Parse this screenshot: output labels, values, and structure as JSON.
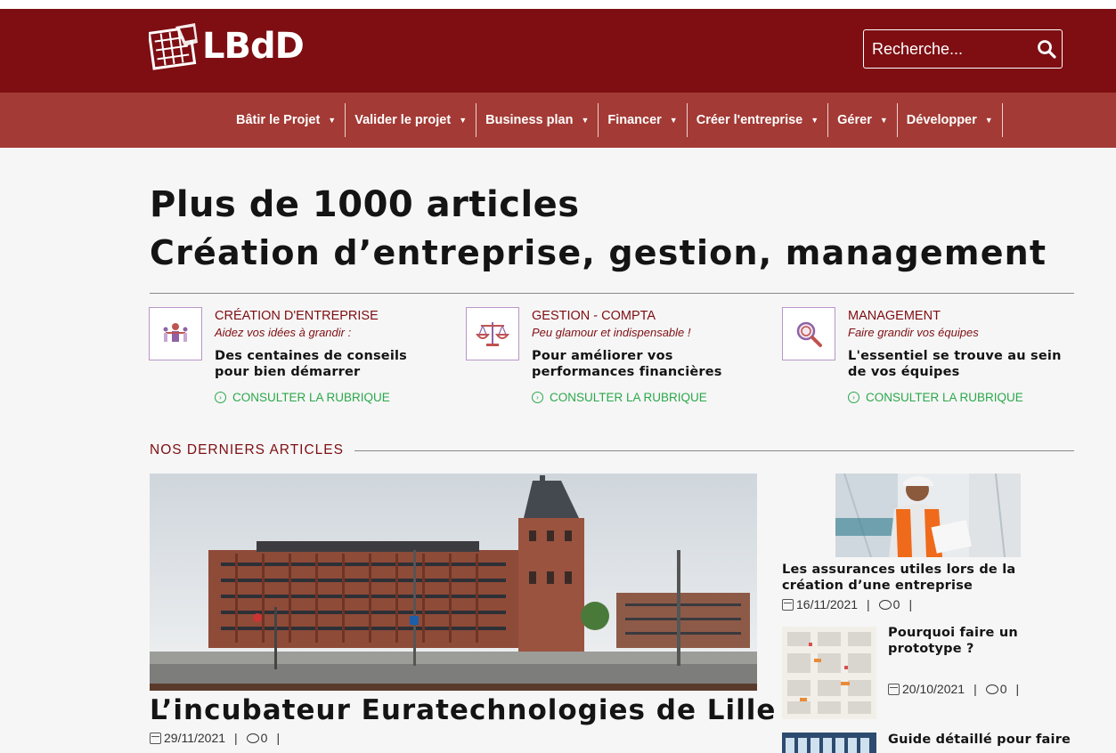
{
  "header": {
    "logo_text": "LBdD",
    "search": {
      "placeholder": "Recherche...",
      "icon": "search-icon"
    },
    "colors": {
      "header_bg": "#7e0e12",
      "nav_bg": "#a33a35",
      "accent_green": "#2aa84a"
    }
  },
  "nav": {
    "items": [
      {
        "label": "Bâtir le Projet"
      },
      {
        "label": "Valider le projet"
      },
      {
        "label": "Business plan"
      },
      {
        "label": "Financer"
      },
      {
        "label": "Créer l'entreprise"
      },
      {
        "label": "Gérer"
      },
      {
        "label": "Développer"
      }
    ]
  },
  "hero": {
    "title": "Plus de 1000 articles",
    "subtitle": "Création d’entreprise, gestion, management"
  },
  "categories": [
    {
      "title": "CRÉATION D'ENTREPRISE",
      "tagline": "Aidez vos idées à grandir :",
      "description": "Des centaines de conseils pour bien démarrer",
      "link": "CONSULTER LA RUBRIQUE",
      "icon": "team-icon"
    },
    {
      "title": "GESTION - COMPTA",
      "tagline": "Peu glamour et indispensable !",
      "description": "Pour améliorer vos performances financières",
      "link": "CONSULTER LA RUBRIQUE",
      "icon": "scale-icon"
    },
    {
      "title": "MANAGEMENT",
      "tagline": "Faire grandir vos équipes",
      "description": "L'essentiel se trouve au sein de vos équipes",
      "link": "CONSULTER LA RUBRIQUE",
      "icon": "magnifier-icon"
    }
  ],
  "latest": {
    "label": "NOS DERNIERS ARTICLES",
    "featured": {
      "title": "L’incubateur Euratechnologies de Lille",
      "date": "29/11/2021",
      "comments": "0"
    },
    "side": [
      {
        "title": "Les assurances utiles lors de la création d’une entreprise",
        "date": "16/11/2021",
        "comments": "0"
      },
      {
        "title": "Pourquoi faire un prototype ?",
        "date": "20/10/2021",
        "comments": "0"
      },
      {
        "title": "Guide détaillé pour faire"
      }
    ]
  }
}
